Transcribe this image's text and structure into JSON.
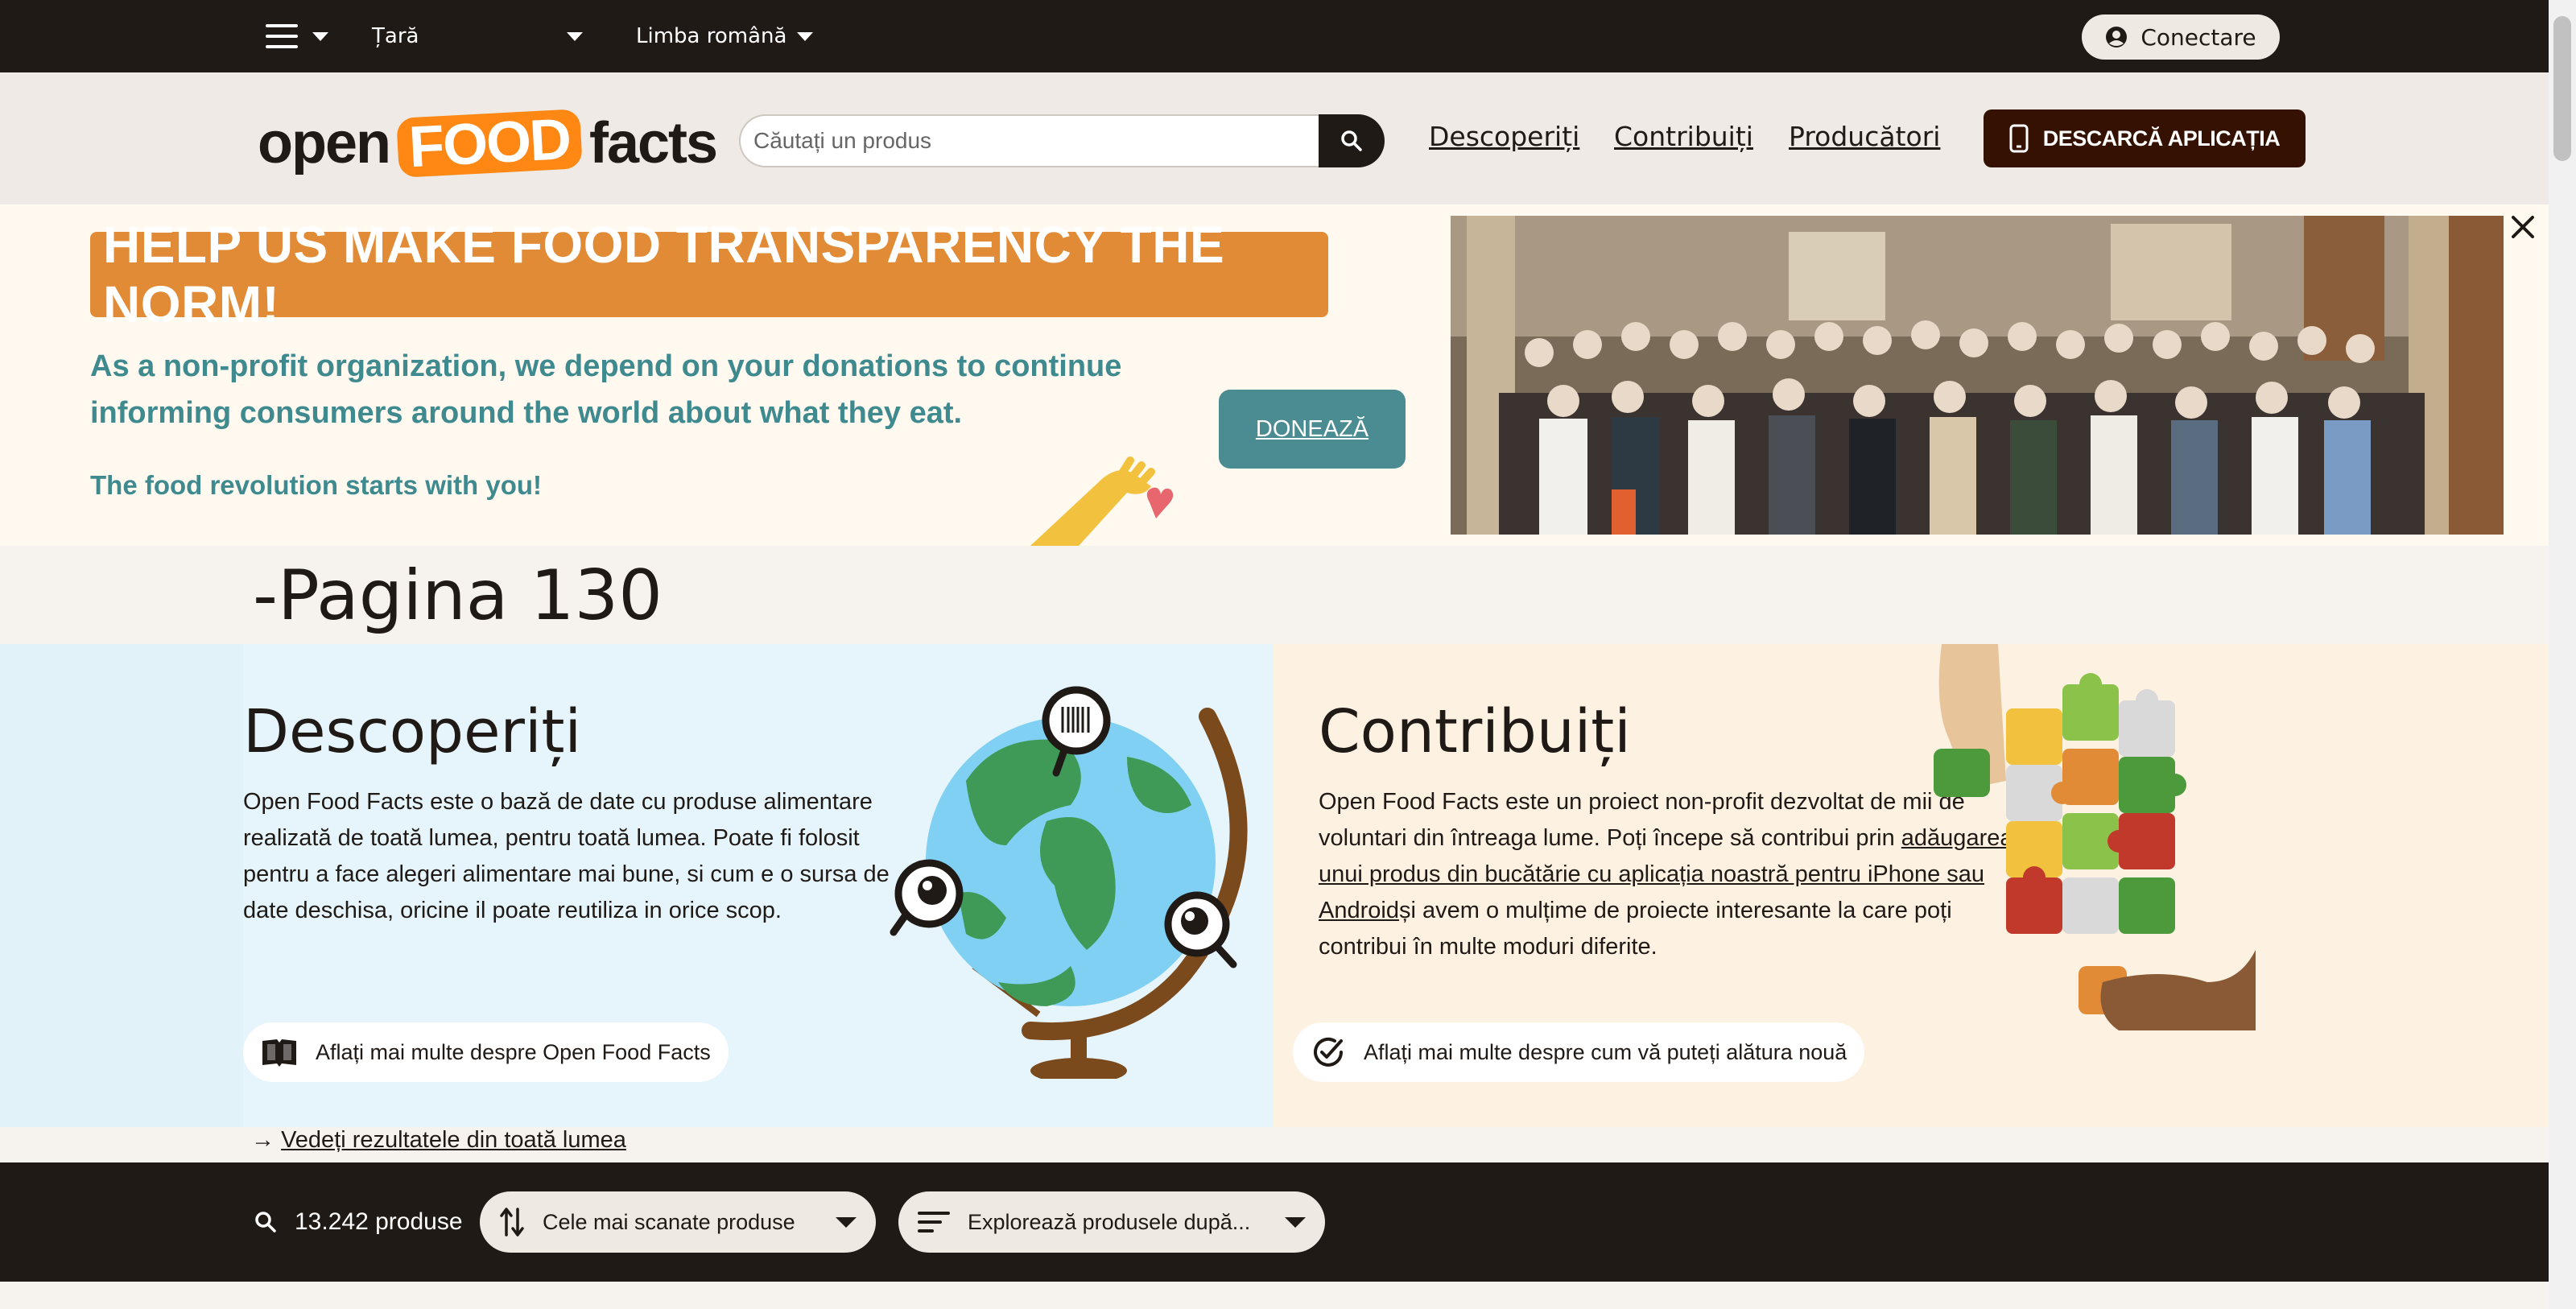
{
  "topbar": {
    "country_label": "Țară",
    "language_label": "Limba română",
    "login_label": "Conectare"
  },
  "header": {
    "logo": {
      "part1": "open",
      "part2": "FOOD",
      "part3": "facts"
    },
    "search_placeholder": "Căutați un produs",
    "nav": {
      "discover": "Descoperiți",
      "contribute": "Contribuiți",
      "producers": "Producători"
    },
    "download_label": "DESCARCĂ APLICAȚIA"
  },
  "banner": {
    "headline": "HELP US MAKE FOOD TRANSPARENCY THE NORM!",
    "text": "As a non-profit organization, we depend on your donations to continue informing consumers around the world about what they eat.",
    "tagline": "The food revolution starts with you!",
    "donate_label": "DONEAZĂ"
  },
  "page_title": "-Pagina 130",
  "discover": {
    "title": "Descoperiți",
    "body": "Open Food Facts este o bază de date cu produse alimentare realizată de toată lumea, pentru toată lumea. Poate fi folosit pentru a face alegeri alimentare mai bune, si cum e o sursa de date deschisa, oricine il poate reutiliza in orice scop.",
    "button": "Aflați mai multe despre Open Food Facts"
  },
  "contribute": {
    "title": "Contribuiți",
    "body_before": "Open Food Facts este un proiect non-profit dezvoltat de mii de voluntari din întreaga lume. Poți începe să contribui prin ",
    "body_link": "adăugarea unui produs din bucătărie cu aplicația noastră pentru iPhone sau Android",
    "body_after": "și avem o mulțime de proiecte interesante la care poți contribui în multe moduri diferite.",
    "button": "Aflați mai multe despre cum vă puteți alătura nouă"
  },
  "world_link": {
    "arrow": "→",
    "label": "Vedeți rezultatele din toată lumea"
  },
  "bottombar": {
    "count": "13.242 produse",
    "sort_label": "Cele mai scanate produse",
    "explore_label": "Explorează produsele după..."
  },
  "colors": {
    "dark": "#201a17",
    "orange": "#e28b36",
    "teal": "#3e8a8f",
    "donate": "#4b8c92",
    "download": "#341100"
  }
}
